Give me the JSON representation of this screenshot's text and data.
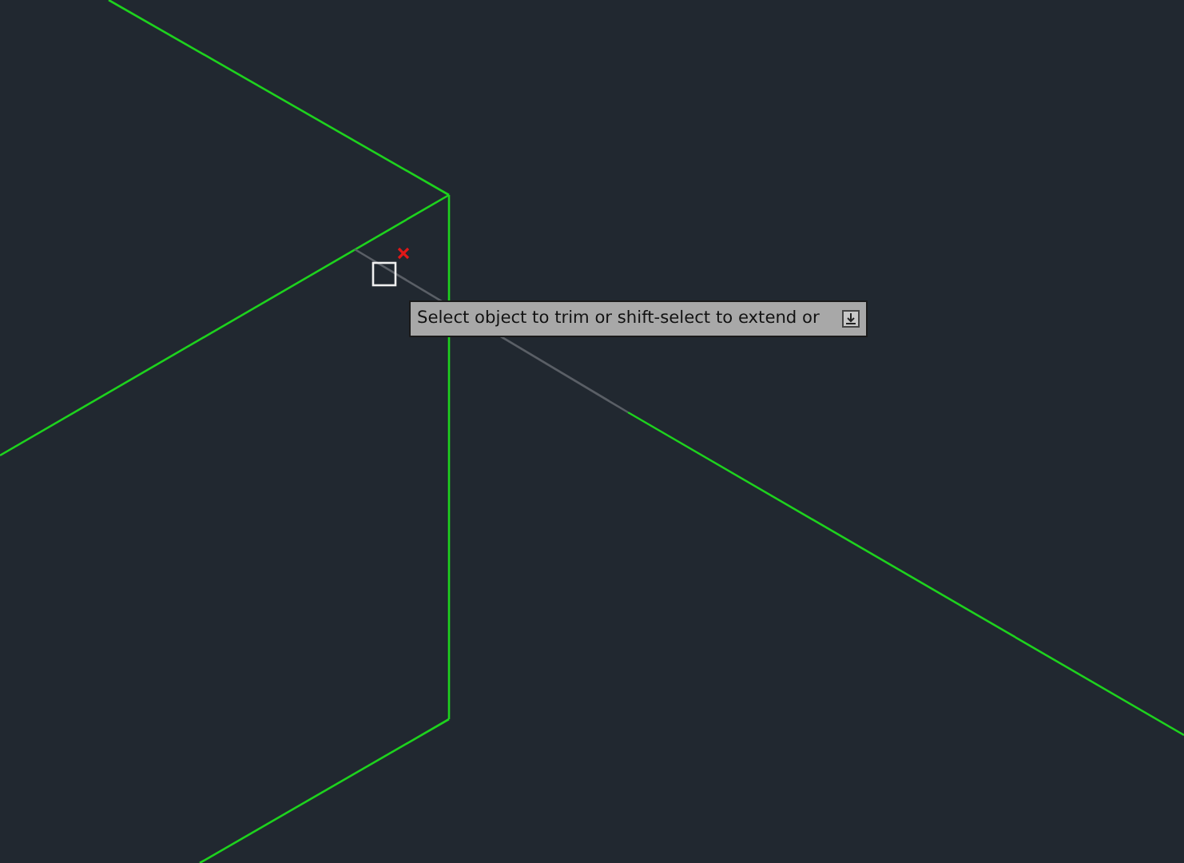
{
  "tooltip": {
    "text": "Select object to trim or shift-select to extend or"
  }
}
